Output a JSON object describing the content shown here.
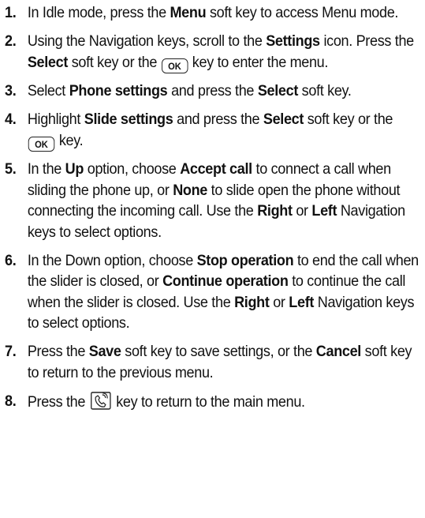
{
  "steps": [
    {
      "num": "1.",
      "parts": [
        {
          "t": "In Idle mode, press the "
        },
        {
          "t": "Menu",
          "b": true
        },
        {
          "t": " soft key to access Menu mode."
        }
      ]
    },
    {
      "num": "2.",
      "parts": [
        {
          "t": "Using the Navigation keys, scroll to the "
        },
        {
          "t": "Settings",
          "b": true
        },
        {
          "t": " icon. Press the "
        },
        {
          "t": "Select",
          "b": true
        },
        {
          "t": " soft key or the "
        },
        {
          "k": "ok-key-icon",
          "label": "OK"
        },
        {
          "t": " key to enter the menu."
        }
      ]
    },
    {
      "num": "3.",
      "parts": [
        {
          "t": "Select "
        },
        {
          "t": "Phone settings",
          "b": true
        },
        {
          "t": " and press the "
        },
        {
          "t": "Select",
          "b": true
        },
        {
          "t": " soft key."
        }
      ]
    },
    {
      "num": "4.",
      "parts": [
        {
          "t": "Highlight "
        },
        {
          "t": "Slide settings",
          "b": true
        },
        {
          "t": " and press the "
        },
        {
          "t": "Select",
          "b": true
        },
        {
          "t": " soft key or the "
        },
        {
          "k": "ok-key-icon",
          "label": "OK"
        },
        {
          "t": " key."
        }
      ]
    },
    {
      "num": "5.",
      "parts": [
        {
          "t": "In the "
        },
        {
          "t": "Up",
          "b": true
        },
        {
          "t": " option, choose "
        },
        {
          "t": "Accept call",
          "b": true
        },
        {
          "t": " to connect a call when sliding the phone up, or "
        },
        {
          "t": "None",
          "b": true
        },
        {
          "t": " to slide open the phone without connecting the incoming call. Use the "
        },
        {
          "t": "Right",
          "b": true
        },
        {
          "t": " or "
        },
        {
          "t": "Left",
          "b": true
        },
        {
          "t": " Navigation keys to select options."
        }
      ]
    },
    {
      "num": "6.",
      "parts": [
        {
          "t": "In the Down option, choose "
        },
        {
          "t": "Stop operation",
          "b": true
        },
        {
          "t": " to end the call when the slider is closed, or "
        },
        {
          "t": "Continue operation",
          "b": true
        },
        {
          "t": " to continue the call when the slider is closed. Use the "
        },
        {
          "t": "Right",
          "b": true
        },
        {
          "t": " or "
        },
        {
          "t": "Left",
          "b": true
        },
        {
          "t": " Navigation keys to select options."
        }
      ]
    },
    {
      "num": "7.",
      "parts": [
        {
          "t": "Press the "
        },
        {
          "t": "Save",
          "b": true
        },
        {
          "t": " soft key to save settings, or the "
        },
        {
          "t": "Cancel",
          "b": true
        },
        {
          "t": " soft key to return to the previous menu."
        }
      ]
    },
    {
      "num": "8.",
      "parts": [
        {
          "t": "Press the "
        },
        {
          "k": "end-key-icon"
        },
        {
          "t": " key to return to the main menu."
        }
      ]
    }
  ]
}
